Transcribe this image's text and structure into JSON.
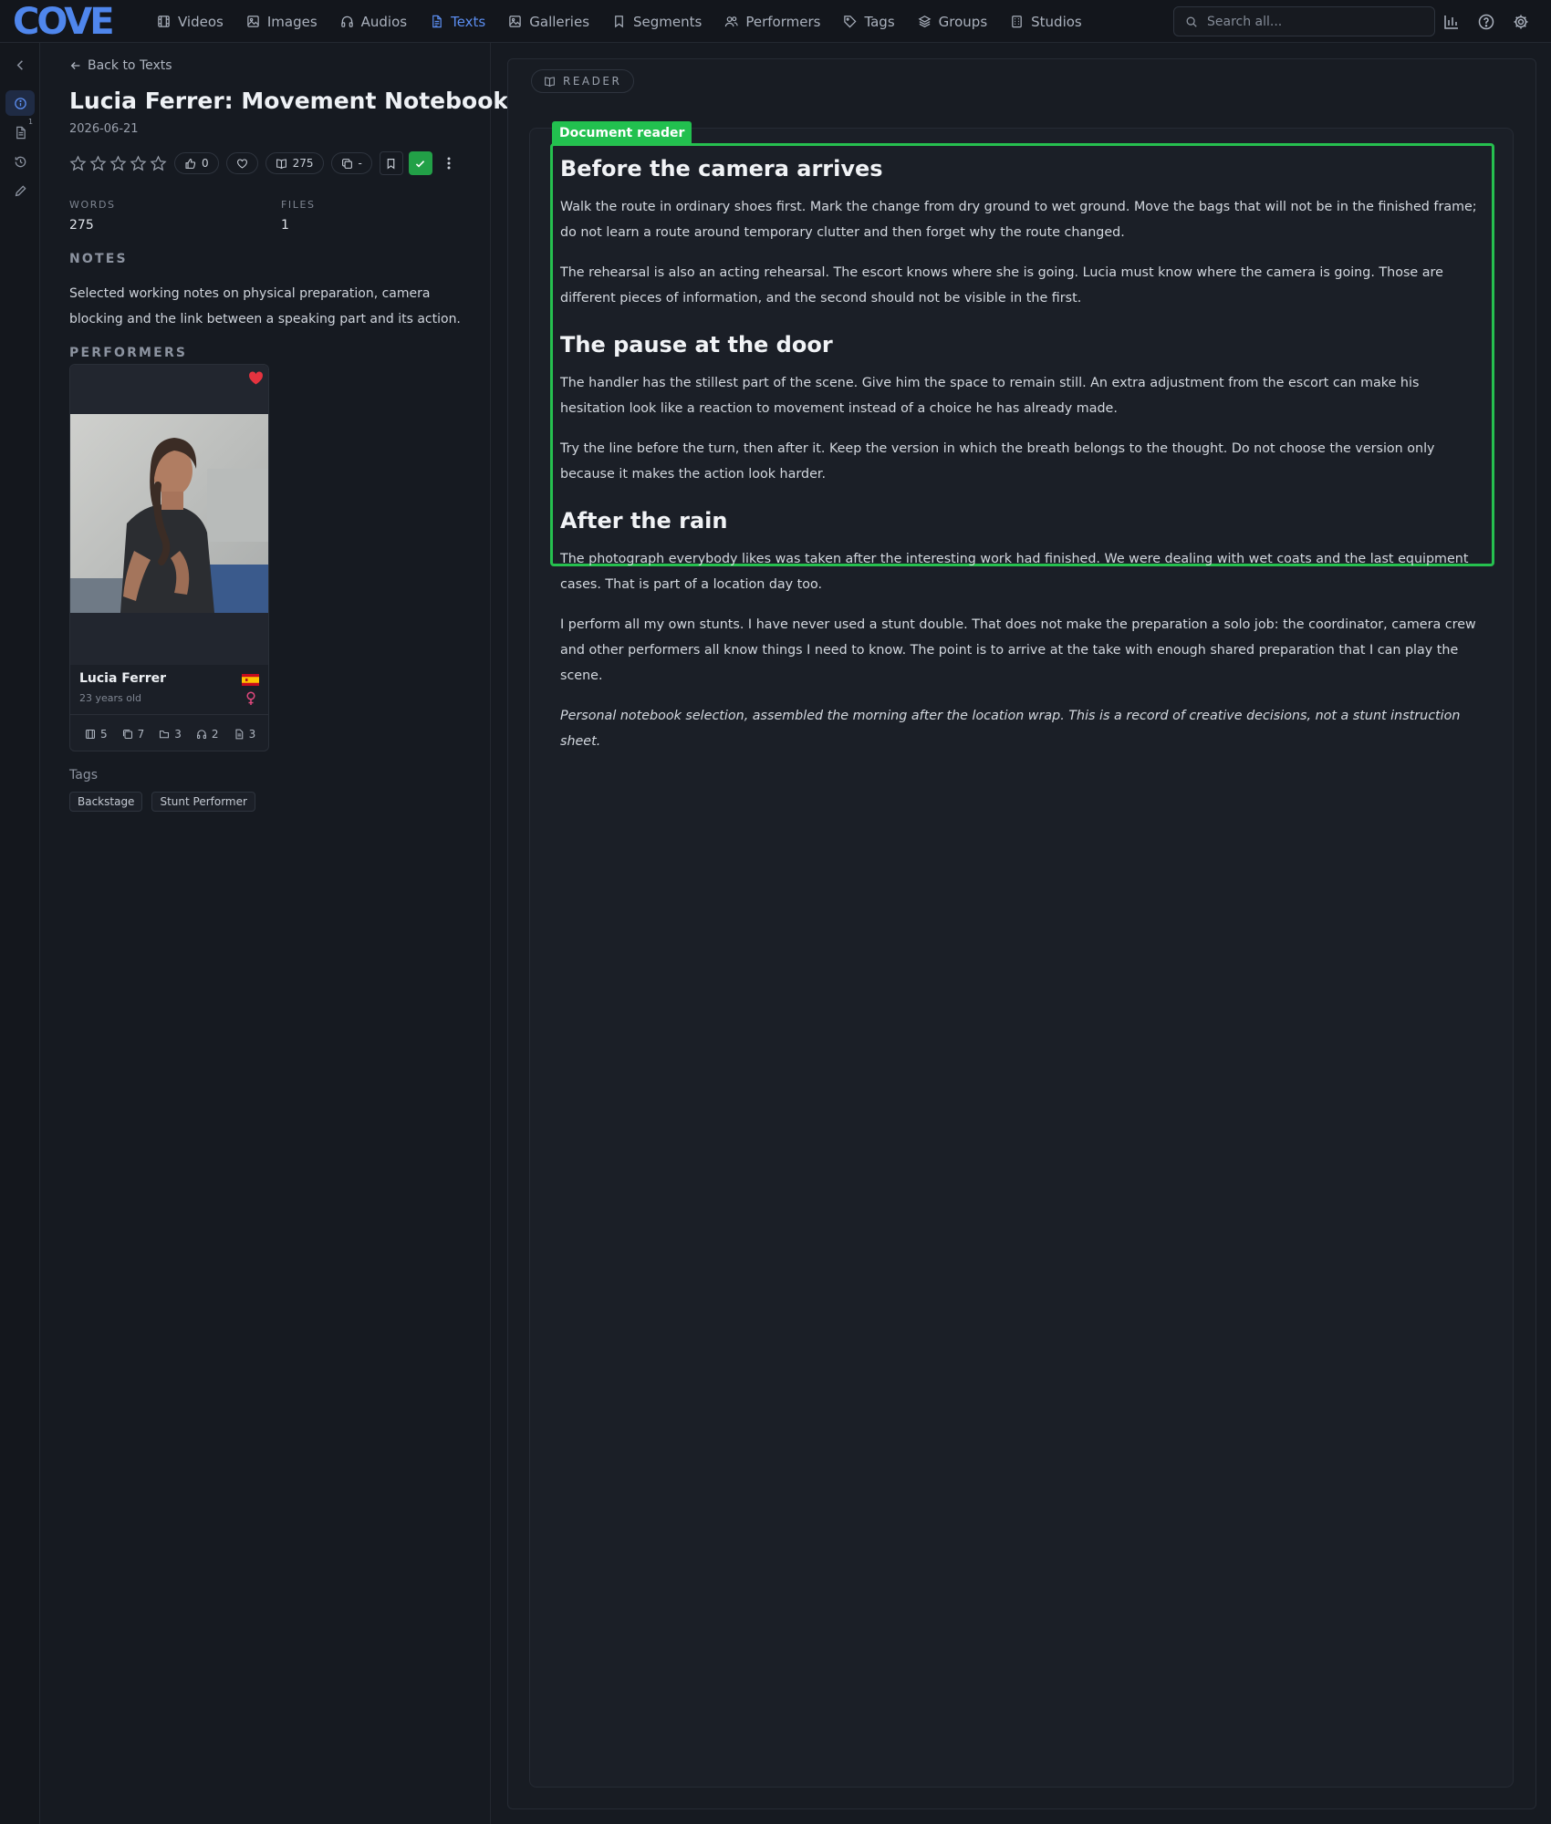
{
  "app": {
    "logo_text": "COVE",
    "accent_color": "#5b8def"
  },
  "nav": {
    "items": [
      {
        "label": "Videos",
        "icon": "film-icon"
      },
      {
        "label": "Images",
        "icon": "image-icon"
      },
      {
        "label": "Audios",
        "icon": "headphones-icon"
      },
      {
        "label": "Texts",
        "icon": "document-icon",
        "active": true
      },
      {
        "label": "Galleries",
        "icon": "gallery-icon"
      },
      {
        "label": "Segments",
        "icon": "bookmark-icon"
      },
      {
        "label": "Performers",
        "icon": "users-icon"
      },
      {
        "label": "Tags",
        "icon": "tag-icon"
      },
      {
        "label": "Groups",
        "icon": "layers-icon"
      },
      {
        "label": "Studios",
        "icon": "building-icon"
      }
    ],
    "search_placeholder": "Search all...",
    "right_icons": [
      "bar-chart-icon",
      "help-icon",
      "settings-icon"
    ]
  },
  "rail": {
    "items": [
      "collapse-icon",
      "info-icon",
      "file-icon",
      "history-icon",
      "edit-icon"
    ],
    "file_badge": "1"
  },
  "detail": {
    "back_label": "Back to Texts",
    "title": "Lucia Ferrer: Movement Notebook",
    "date": "2026-06-21",
    "rating": 0,
    "likes": "0",
    "word_count_pill": "275",
    "copies_pill": "-",
    "organized": true,
    "stats": {
      "words_label": "WORDS",
      "words_value": "275",
      "files_label": "FILES",
      "files_value": "1"
    },
    "notes_label": "NOTES",
    "notes": "Selected working notes on physical preparation, camera blocking and the link between a speaking part and its action.",
    "performers_label": "PERFORMERS",
    "tags_label": "Tags",
    "tags": [
      "Backstage",
      "Stunt Performer"
    ]
  },
  "performer": {
    "name": "Lucia Ferrer",
    "age": "23 years old",
    "favorite": true,
    "flag": "Spain",
    "gender_icon": "female-icon",
    "counts": [
      {
        "icon": "film-icon",
        "value": "5"
      },
      {
        "icon": "images-icon",
        "value": "7"
      },
      {
        "icon": "folder-icon",
        "value": "3"
      },
      {
        "icon": "headphones-icon",
        "value": "2"
      },
      {
        "icon": "document-icon",
        "value": "3"
      }
    ]
  },
  "reader": {
    "badge": "READER",
    "doc_label": "Document reader",
    "doc_label_color": "#22c04f",
    "heading_1": "Before the camera arrives",
    "p1": "Walk the route in ordinary shoes first. Mark the change from dry ground to wet ground. Move the bags that will not be in the finished frame; do not learn a route around temporary clutter and then forget why the route changed.",
    "p2": "The rehearsal is also an acting rehearsal. The escort knows where she is going. Lucia must know where the camera is going. Those are different pieces of information, and the second should not be visible in the first.",
    "heading_2": "The pause at the door",
    "p3": "The handler has the stillest part of the scene. Give him the space to remain still. An extra adjustment from the escort can make his hesitation look like a reaction to movement instead of a choice he has already made.",
    "p4": "Try the line before the turn, then after it. Keep the version in which the breath belongs to the thought. Do not choose the version only because it makes the action look harder.",
    "heading_3": "After the rain",
    "p5": "The photograph everybody likes was taken after the interesting work had finished. We were dealing with wet coats and the last equipment cases. That is part of a location day too.",
    "p6": "I perform all my own stunts. I have never used a stunt double. That does not make the preparation a solo job: the coordinator, camera crew and other performers all know things I need to know. The point is to arrive at the take with enough shared preparation that I can play the scene.",
    "p7": "Personal notebook selection, assembled the morning after the location wrap. This is a record of creative decisions, not a stunt instruction sheet."
  }
}
